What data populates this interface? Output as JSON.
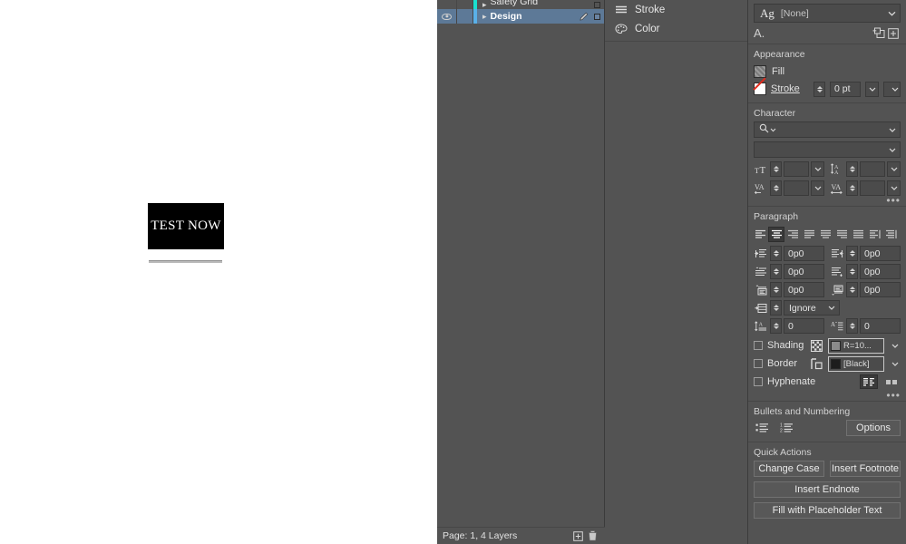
{
  "canvas": {
    "text_frame_content": "TEST NOW"
  },
  "layers_panel": {
    "layers": [
      {
        "name": "Safety Grid",
        "color": "#19e0d0",
        "visible": false,
        "selected": false,
        "locked": false
      },
      {
        "name": "Design",
        "color": "#5ab0e8",
        "visible": true,
        "selected": true,
        "locked": false
      }
    ],
    "status_text": "Page: 1, 4 Layers",
    "new_layer_icon": "new-layer-icon",
    "delete_layer_icon": "trash-icon"
  },
  "dock": {
    "items": [
      {
        "label": "Stroke",
        "icon": "stroke-lines-icon"
      },
      {
        "label": "Color",
        "icon": "color-palette-icon"
      }
    ]
  },
  "properties": {
    "paragraph_style": {
      "prefix": "Ag",
      "value": "[None]"
    },
    "type_row": {
      "label": "A.",
      "new_style_icon": "new-style-icon",
      "add_icon": "add-item-icon"
    },
    "appearance": {
      "title": "Appearance",
      "fill_label": "Fill",
      "stroke_label": "Stroke",
      "stroke_weight": "0 pt",
      "stroke_type": ""
    },
    "character": {
      "title": "Character",
      "font_family": "",
      "font_family_placeholder": "",
      "font_style": "",
      "font_size": "",
      "leading": "",
      "kerning": "",
      "tracking": "",
      "icons": {
        "size": "font-size-icon",
        "leading": "leading-icon",
        "kerning": "kerning-icon",
        "tracking": "tracking-icon",
        "search": "search-icon"
      }
    },
    "paragraph": {
      "title": "Paragraph",
      "alignments": [
        {
          "name": "align-left",
          "active": false
        },
        {
          "name": "align-center",
          "active": true
        },
        {
          "name": "align-right",
          "active": false
        },
        {
          "name": "justify-left",
          "active": false
        },
        {
          "name": "justify-center",
          "active": false
        },
        {
          "name": "justify-right",
          "active": false
        },
        {
          "name": "justify-all",
          "active": false
        },
        {
          "name": "align-toward-spine",
          "active": false
        },
        {
          "name": "align-away-spine",
          "active": false
        }
      ],
      "left_indent": "0p0",
      "right_indent": "0p0",
      "first_line_indent": "0p0",
      "last_line_indent": "0p0",
      "space_before": "0p0",
      "space_after": "0p0",
      "align_to_grid": "Ignore",
      "drop_cap_lines": "0",
      "drop_cap_chars": "0",
      "shading_label": "Shading",
      "shading_color": "R=10...",
      "border_label": "Border",
      "border_color": "[Black]",
      "hyphenate_label": "Hyphenate",
      "balance_icon": "balance-ragged-lines-icon",
      "columns_icon": "span-columns-icon"
    },
    "bullets": {
      "title": "Bullets and Numbering",
      "bulleted_icon": "bulleted-list-icon",
      "numbered_icon": "numbered-list-icon",
      "options_label": "Options"
    },
    "quick_actions": {
      "title": "Quick Actions",
      "change_case": "Change Case",
      "insert_footnote": "Insert Footnote",
      "insert_endnote": "Insert Endnote",
      "fill_placeholder": "Fill with Placeholder Text"
    }
  },
  "colors": {
    "panel_bg": "#535353",
    "field_bg": "#4b4b4b",
    "selection_blue": "#5d7997",
    "canvas_bg": "#ffffff",
    "text_frame_bg": "#000000"
  }
}
